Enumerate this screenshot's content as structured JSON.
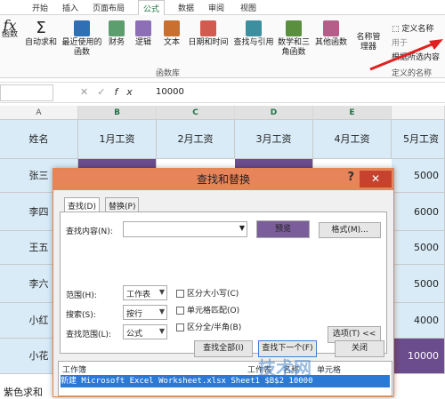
{
  "ribbon_tabs": [
    "开始",
    "插入",
    "页面布局",
    "公式",
    "数据",
    "审阅",
    "视图"
  ],
  "ribbon": {
    "fx_label": "函数",
    "buttons": [
      "自动求和",
      "最近使用的函数",
      "财务",
      "逻辑",
      "文本",
      "日期和时间",
      "查找与引用",
      "数学和三角函数",
      "其他函数",
      "名称管理器"
    ],
    "group_label": "函数库",
    "define_name": "定义名称",
    "use_in_formula": "用于",
    "from_selection": "根据所选内容",
    "defined_names_label": "定义的名称"
  },
  "formula_bar": {
    "value": "10000",
    "fx": "fx"
  },
  "columns": [
    "A",
    "B",
    "C",
    "D",
    "E"
  ],
  "headers": [
    "姓名",
    "1月工资",
    "2月工资",
    "3月工资",
    "4月工资",
    "5月工资"
  ],
  "names": [
    "张三",
    "李四",
    "王五",
    "李六",
    "小红",
    "小花"
  ],
  "f_values": [
    "5000",
    "6000",
    "5000",
    "5000",
    "4000",
    "10000"
  ],
  "bottom_text": "紫色求和",
  "dialog": {
    "title": "查找和替换",
    "q": "?",
    "close": "✕",
    "tabs": [
      "查找(D)",
      "替换(P)"
    ],
    "find_label": "查找内容(N):",
    "preview": "预览",
    "format_btn": "格式(M)...",
    "scope_label": "范围(H):",
    "scope_value": "工作表",
    "search_label": "搜索(S):",
    "search_value": "按行",
    "lookin_label": "查找范围(L):",
    "lookin_value": "公式",
    "match_case": "区分大小写(C)",
    "match_cell": "单元格匹配(O)",
    "match_width": "区分全/半角(B)",
    "options_btn": "选项(T) <<",
    "find_all": "查找全部(I)",
    "find_next": "查找下一个(F)",
    "close_btn": "关闭",
    "results_headers": [
      "工作簿",
      "工作表",
      "名称",
      "单元格"
    ],
    "result_row": "新建 Microsoft Excel Worksheet.xlsx   Sheet1          $B$2  10000"
  },
  "watermark": "技术网"
}
